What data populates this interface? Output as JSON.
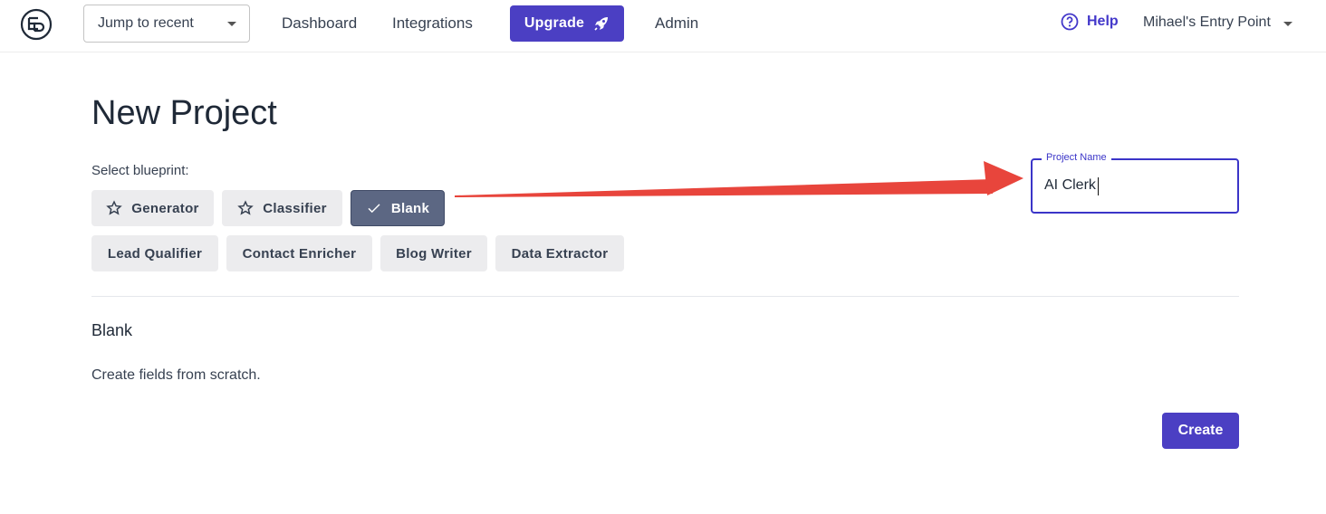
{
  "topbar": {
    "jump_label": "Jump to recent",
    "nav": [
      "Dashboard",
      "Integrations"
    ],
    "upgrade_label": "Upgrade",
    "admin_label": "Admin",
    "help_label": "Help",
    "account_label": "Mihael's Entry Point"
  },
  "page": {
    "title": "New Project",
    "select_label": "Select blueprint:",
    "blueprints_row1": [
      {
        "label": "Generator",
        "icon": "star-icon",
        "selected": false
      },
      {
        "label": "Classifier",
        "icon": "star-icon",
        "selected": false
      },
      {
        "label": "Blank",
        "icon": "check-icon",
        "selected": true
      }
    ],
    "blueprints_row2": [
      {
        "label": "Lead Qualifier"
      },
      {
        "label": "Contact Enricher"
      },
      {
        "label": "Blog Writer"
      },
      {
        "label": "Data Extractor"
      }
    ],
    "section_title": "Blank",
    "section_desc": "Create fields from scratch.",
    "create_label": "Create"
  },
  "project_name": {
    "label": "Project Name",
    "value": "AI Clerk"
  },
  "colors": {
    "primary": "#4b3fc3",
    "selected_chip": "#5c6783",
    "chip": "#ececee",
    "arrow": "#e8453c"
  }
}
